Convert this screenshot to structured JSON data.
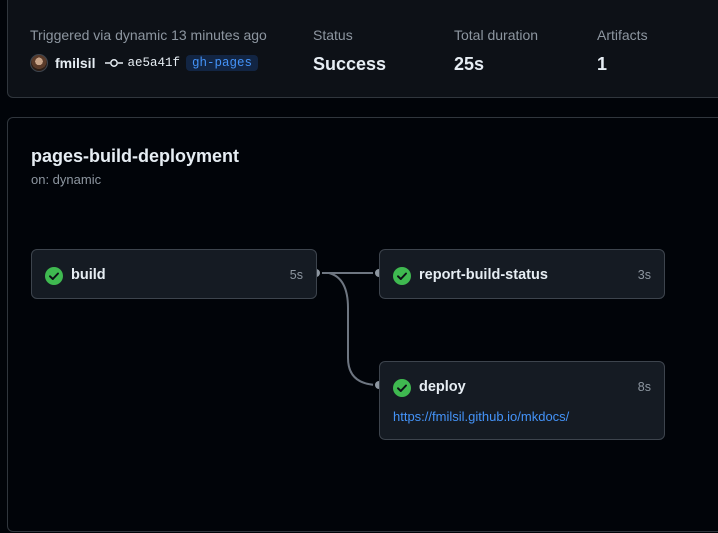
{
  "run": {
    "trigger_text": "Triggered via dynamic 13 minutes ago",
    "actor": "fmilsil",
    "commit": "ae5a41f",
    "branch": "gh-pages",
    "status_label": "Status",
    "status_value": "Success",
    "duration_label": "Total duration",
    "duration_value": "25s",
    "artifacts_label": "Artifacts",
    "artifacts_value": "1"
  },
  "workflow": {
    "title": "pages-build-deployment",
    "trigger": "on: dynamic"
  },
  "jobs": [
    {
      "name": "build",
      "duration": "5s",
      "status": "success"
    },
    {
      "name": "report-build-status",
      "duration": "3s",
      "status": "success"
    },
    {
      "name": "deploy",
      "duration": "8s",
      "status": "success",
      "url": "https://fmilsil.github.io/mkdocs/"
    }
  ],
  "colors": {
    "success": "#3fb950",
    "link": "#4493f8",
    "background": "#010409",
    "card": "#151b23",
    "border": "#3d444d"
  },
  "icons": {
    "commit": "git-commit-icon",
    "job_status": "check-circle-icon",
    "connector": "connector-dot-icon"
  }
}
